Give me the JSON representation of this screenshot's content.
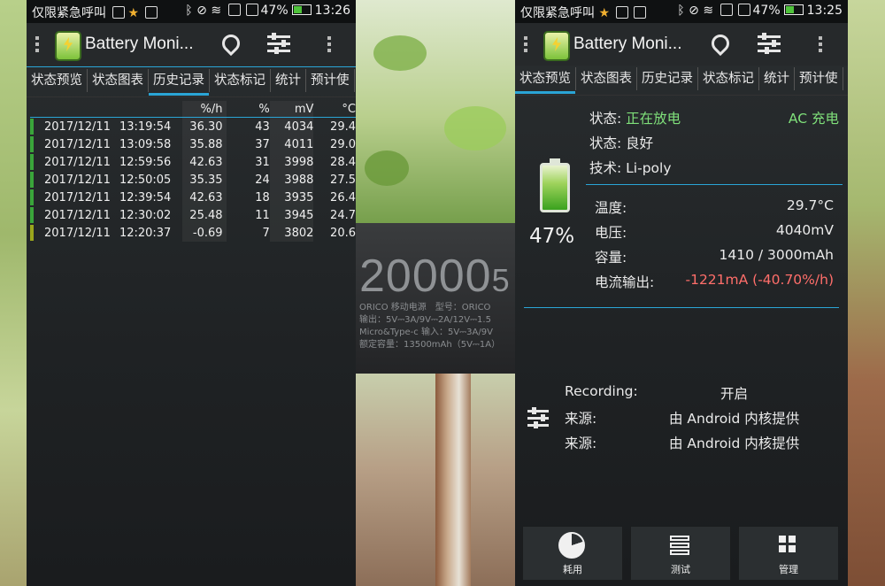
{
  "left_phone": {
    "status": {
      "emergency": "仅限紧急呼叫",
      "battery": "47%",
      "time": "13:26"
    },
    "app_title": "Battery Moni...",
    "tabs": [
      "状态预览",
      "状态图表",
      "历史记录",
      "状态标记",
      "统计",
      "预计使"
    ],
    "active_tab": "历史记录",
    "table": {
      "headers": [
        "%/h",
        "%",
        "mV",
        "°C"
      ],
      "rows": [
        {
          "date": "2017/12/11",
          "time": "13:19:54",
          "rate": "36.30",
          "pct": "43",
          "mv": "4034",
          "temp": "29.4"
        },
        {
          "date": "2017/12/11",
          "time": "13:09:58",
          "rate": "35.88",
          "pct": "37",
          "mv": "4011",
          "temp": "29.0"
        },
        {
          "date": "2017/12/11",
          "time": "12:59:56",
          "rate": "42.63",
          "pct": "31",
          "mv": "3998",
          "temp": "28.4"
        },
        {
          "date": "2017/12/11",
          "time": "12:50:05",
          "rate": "35.35",
          "pct": "24",
          "mv": "3988",
          "temp": "27.5"
        },
        {
          "date": "2017/12/11",
          "time": "12:39:54",
          "rate": "42.63",
          "pct": "18",
          "mv": "3935",
          "temp": "26.4"
        },
        {
          "date": "2017/12/11",
          "time": "12:30:02",
          "rate": "25.48",
          "pct": "11",
          "mv": "3945",
          "temp": "24.7"
        },
        {
          "date": "2017/12/11",
          "time": "12:20:37",
          "rate": "-0.69",
          "pct": "7",
          "mv": "3802",
          "temp": "20.6"
        }
      ]
    }
  },
  "right_phone": {
    "status": {
      "emergency": "仅限紧急呼叫",
      "battery": "47%",
      "time": "13:25"
    },
    "app_title": "Battery Moni...",
    "tabs": [
      "状态预览",
      "状态图表",
      "历史记录",
      "状态标记",
      "统计",
      "预计使"
    ],
    "active_tab": "状态预览",
    "battery_percent": "47%",
    "status_label": "状态:",
    "status_value": "正在放电",
    "ac_label": "AC 充电",
    "health_label": "状态:",
    "health_value": "良好",
    "tech_label": "技术:",
    "tech_value": "Li-poly",
    "temp_label": "温度:",
    "temp_value": "29.7°C",
    "voltage_label": "电压:",
    "voltage_value": "4040mV",
    "capacity_label": "容量:",
    "capacity_value": "1410 / 3000mAh",
    "current_label": "电流输出:",
    "current_value": "-1221mA (-40.70%/h)",
    "recording_label": "Recording:",
    "recording_value": "开启",
    "source1_label": "来源:",
    "source1_value": "由 Android 内核提供",
    "source2_label": "来源:",
    "source2_value": "由 Android 内核提供",
    "buttons": [
      "耗用",
      "测试",
      "管理"
    ]
  },
  "background": {
    "powerbank_big": "20000",
    "powerbank_big_partial": "5",
    "powerbank_line1": "ORICO 移动电源　型号：ORICO",
    "powerbank_line2": "输出：5V⎓3A/9V⎓2A/12V⎓1.5",
    "powerbank_line3": "Micro&Type-c 输入：5V⎓3A/9V",
    "powerbank_line4": "额定容量：13500mAh（5V⎓1A）"
  },
  "colors": {
    "accent": "#2aa5d6",
    "green_text": "#7fe07a",
    "red_text": "#ff6e6a",
    "marker_green": "#3aa53a",
    "marker_olive": "#9aa51c"
  }
}
